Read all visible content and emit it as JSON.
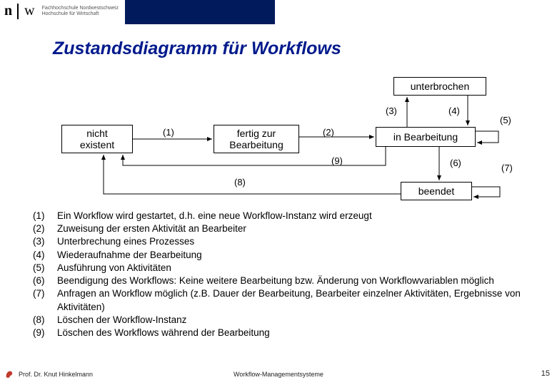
{
  "header": {
    "logo_n": "n",
    "logo_w": "w",
    "institution_line1": "Fachhochschule Nordwestschweiz",
    "institution_line2": "Hochschule für Wirtschaft"
  },
  "title": "Zustandsdiagramm für Workflows",
  "states": {
    "unterbrochen": "unterbrochen",
    "nicht_existent": "nicht\nexistent",
    "fertig": "fertig zur\nBearbeitung",
    "in_bearbeitung": "in Bearbeitung",
    "beendet": "beendet"
  },
  "edge_labels": {
    "e1": "(1)",
    "e2": "(2)",
    "e3": "(3)",
    "e4": "(4)",
    "e5": "(5)",
    "e6": "(6)",
    "e7": "(7)",
    "e8": "(8)",
    "e9": "(9)"
  },
  "legend": [
    {
      "n": "(1)",
      "t": "Ein Workflow wird gestartet, d.h. eine neue Workflow-Instanz wird erzeugt"
    },
    {
      "n": "(2)",
      "t": "Zuweisung der ersten Aktivität an Bearbeiter"
    },
    {
      "n": "(3)",
      "t": "Unterbrechung eines Prozesses"
    },
    {
      "n": "(4)",
      "t": "Wiederaufnahme der Bearbeitung"
    },
    {
      "n": "(5)",
      "t": "Ausführung von Aktivitäten"
    },
    {
      "n": "(6)",
      "t": "Beendigung des Workflows: Keine weitere Bearbeitung bzw. Änderung von Workflowvariablen  möglich"
    },
    {
      "n": "(7)",
      "t": "Anfragen an Workflow möglich (z.B. Dauer der Bearbeitung, Bearbeiter einzelner Aktivitäten, Ergebnisse von Aktivitäten)"
    },
    {
      "n": "(8)",
      "t": "Löschen der Workflow-Instanz"
    },
    {
      "n": "(9)",
      "t": "Löschen des Workflows während der Bearbeitung"
    }
  ],
  "footer": {
    "author": "Prof. Dr. Knut Hinkelmann",
    "center": "Workflow-Managementsysteme",
    "page": "15"
  }
}
